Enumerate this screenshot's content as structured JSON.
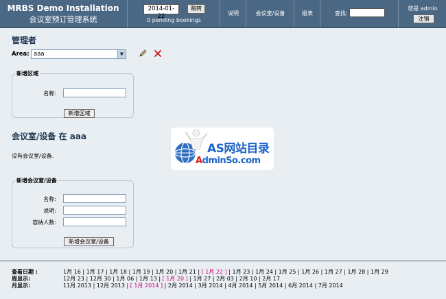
{
  "header": {
    "title": "MRBS Demo Installation",
    "subtitle": "会议室预订管理系统",
    "date_value": "2014-01-22",
    "goto_label": "跳转",
    "pending": "0 pending bookings",
    "nav": {
      "help": "说明",
      "rooms": "会议室/设备",
      "report": "报表"
    },
    "search_label": "查找:",
    "user_info": "您是 admin",
    "logout_label": "注销"
  },
  "main": {
    "admin_heading": "管理者",
    "area_label": "Area:",
    "area_value": "aaa",
    "area_form": {
      "legend": "新增区域",
      "name_label": "名称:",
      "submit": "新增区域"
    },
    "rooms_heading": "会议室/设备 在 aaa",
    "no_rooms": "没有会议室/设备.",
    "room_form": {
      "legend": "新增会议室/设备",
      "name_label": "名称:",
      "desc_label": "说明:",
      "capacity_label": "容纳人数:",
      "submit": "新增会议室/设备"
    }
  },
  "watermark": {
    "line1": "AS网站目录",
    "line2_a": "A",
    "line2_b": "dminSo.com"
  },
  "footer": {
    "day_label": "查看日期 :",
    "week_label": "周显示:",
    "month_label": "月显示:",
    "days": [
      "1月 16",
      "1月 17",
      "1月 18",
      "1月 19",
      "1月 20",
      "1月 21",
      "[ 1月 22 ]",
      "1月 23",
      "1月 24",
      "1月 25",
      "1月 26",
      "1月 27",
      "1月 28",
      "1月 29"
    ],
    "weeks": [
      "12月 23",
      "12月 30",
      "1月 06",
      "1月 13",
      "[ 1月 20 ]",
      "1月 27",
      "2月 03",
      "2月 10",
      "2月 17"
    ],
    "months": [
      "11月 2013",
      "12月 2013",
      "[ 1月 2014 ]",
      "2月 2014",
      "3月 2014",
      "4月 2014",
      "5月 2014",
      "6月 2014",
      "7月 2014"
    ],
    "current_day_index": 6,
    "current_week_index": 4,
    "current_month_index": 2
  }
}
